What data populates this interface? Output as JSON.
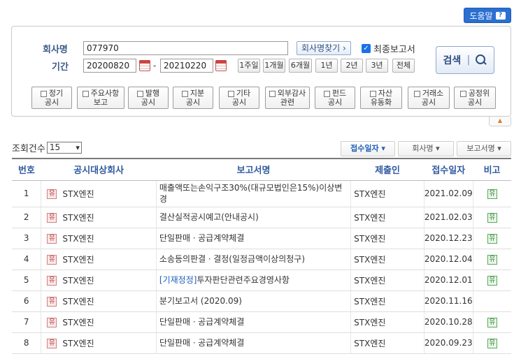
{
  "help": {
    "label": "도움말",
    "icon": "question-icon"
  },
  "search": {
    "company_label": "회사명",
    "company_value": "077970",
    "find_company_label": "회사명찾기 ›",
    "final_report_label": "최종보고서",
    "period_label": "기간",
    "start_date": "20200820",
    "end_date": "20210220",
    "date_sep": "-",
    "period_buttons": [
      "1주일",
      "1개월",
      "6개월",
      "1년",
      "2년",
      "3년",
      "전체"
    ],
    "search_label": "검색",
    "categories": [
      {
        "line1": "정기",
        "line2": "공시"
      },
      {
        "line1": "주요사항",
        "line2": "보고"
      },
      {
        "line1": "발행",
        "line2": "공시"
      },
      {
        "line1": "지분",
        "line2": "공시"
      },
      {
        "line1": "기타",
        "line2": "공시"
      },
      {
        "line1": "외부감사",
        "line2": "관련"
      },
      {
        "line1": "펀드",
        "line2": "공시"
      },
      {
        "line1": "자산",
        "line2": "유동화"
      },
      {
        "line1": "거래소",
        "line2": "공시"
      },
      {
        "line1": "공정위",
        "line2": "공시"
      }
    ]
  },
  "list": {
    "count_label": "조회건수",
    "count_value": "15",
    "sort_buttons": [
      {
        "label": "접수일자 ▾",
        "active": true
      },
      {
        "label": "회사명 ▾",
        "active": false
      },
      {
        "label": "보고서명 ▾",
        "active": false
      }
    ],
    "headers": [
      "번호",
      "공시대상회사",
      "보고서명",
      "제출인",
      "접수일자",
      "비고"
    ],
    "market_badge": "유",
    "rows": [
      {
        "no": "1",
        "company": "STX엔진",
        "prefix": "",
        "report": "매출액또는손익구조30%(대규모법인은15%)이상변경",
        "submitter": "STX엔진",
        "date": "2021.02.09",
        "note": "유"
      },
      {
        "no": "2",
        "company": "STX엔진",
        "prefix": "",
        "report": "결산실적공시예고(안내공시)",
        "submitter": "STX엔진",
        "date": "2021.02.03",
        "note": "유"
      },
      {
        "no": "3",
        "company": "STX엔진",
        "prefix": "",
        "report": "단일판매ㆍ공급계약체결",
        "submitter": "STX엔진",
        "date": "2020.12.23",
        "note": "유"
      },
      {
        "no": "4",
        "company": "STX엔진",
        "prefix": "",
        "report": "소송등의판결ㆍ결정(일정금액이상의청구)",
        "submitter": "STX엔진",
        "date": "2020.12.04",
        "note": "유"
      },
      {
        "no": "5",
        "company": "STX엔진",
        "prefix": "[기재정정]",
        "report": "투자판단관련주요경영사항",
        "submitter": "STX엔진",
        "date": "2020.12.01",
        "note": "유"
      },
      {
        "no": "6",
        "company": "STX엔진",
        "prefix": "",
        "report": "분기보고서 (2020.09)",
        "submitter": "STX엔진",
        "date": "2020.11.16",
        "note": ""
      },
      {
        "no": "7",
        "company": "STX엔진",
        "prefix": "",
        "report": "단일판매ㆍ공급계약체결",
        "submitter": "STX엔진",
        "date": "2020.10.28",
        "note": "유"
      },
      {
        "no": "8",
        "company": "STX엔진",
        "prefix": "",
        "report": "단일판매ㆍ공급계약체결",
        "submitter": "STX엔진",
        "date": "2020.09.23",
        "note": "유"
      }
    ]
  },
  "colors": {
    "accent": "#2a6fd1",
    "header_text": "#2f5aa0",
    "market_badge": "#b33",
    "note_badge": "#2d8a2d"
  }
}
